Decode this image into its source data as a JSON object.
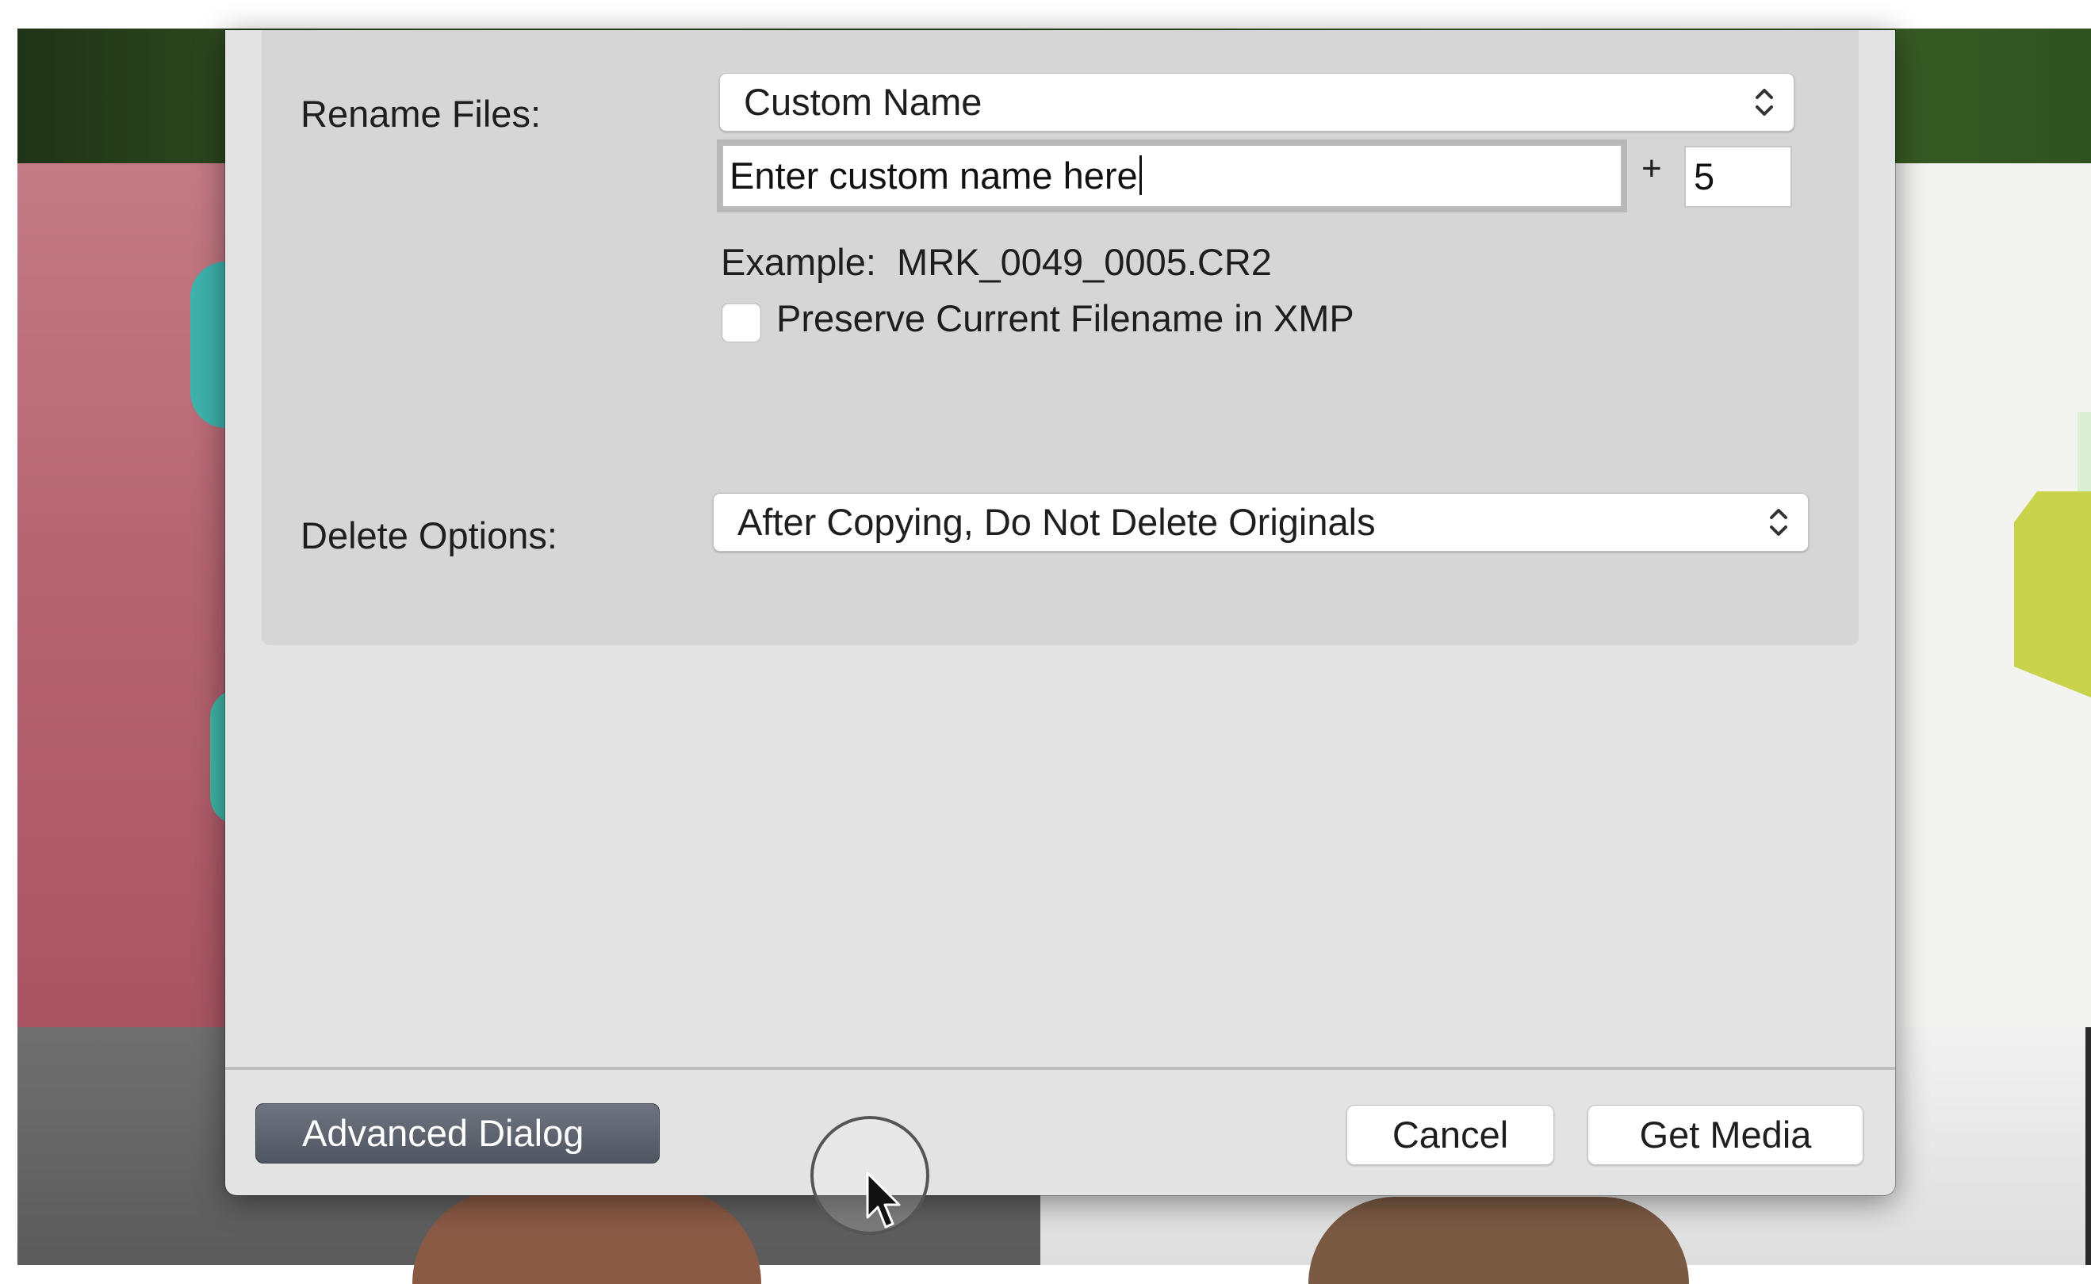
{
  "dialog": {
    "rename_files": {
      "label": "Rename Files:",
      "selected_option": "Custom Name",
      "custom_name_value": "Enter custom name here",
      "plus_symbol": "+",
      "start_number": "5",
      "example_text": "Example:  MRK_0049_0005.CR2",
      "preserve_checkbox_label": "Preserve Current Filename in XMP",
      "preserve_checked": false
    },
    "delete_options": {
      "label": "Delete Options:",
      "selected_option": "After Copying, Do Not Delete Originals"
    },
    "buttons": {
      "advanced": "Advanced Dialog",
      "cancel": "Cancel",
      "get_media": "Get Media"
    }
  },
  "icons": {
    "select_stepper": "chevron-up-down-icon",
    "cursor": "mouse-pointer-icon"
  },
  "colors": {
    "dialog_bg": "#e3e3e3",
    "panel_bg": "#d6d6d6",
    "advanced_button_bg": "#5c626d"
  }
}
